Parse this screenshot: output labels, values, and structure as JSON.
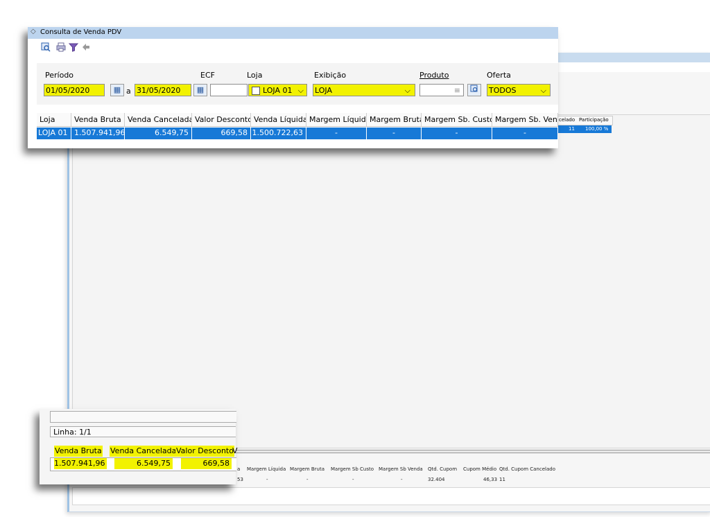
{
  "window": {
    "title": "Consulta de Venda PDV"
  },
  "filters": {
    "periodo_label": "Período",
    "periodo_start": "01/05/2020",
    "periodo_sep": "a",
    "periodo_end": "31/05/2020",
    "ecf_label": "ECF",
    "ecf_value": "",
    "loja_label": "Loja",
    "loja_value": "LOJA 01",
    "exibicao_label": "Exibição",
    "exibicao_value": "LOJA",
    "produto_label": "Produto",
    "produto_value": "",
    "oferta_label": "Oferta",
    "oferta_value": "TODOS"
  },
  "grid": {
    "headers": [
      "Loja",
      "Venda Bruta",
      "Venda Cancelada",
      "Valor Desconto",
      "Venda Líquida",
      "Margem Líquida",
      "Margem Bruta",
      "Margem Sb. Custo",
      "Margem Sb. Venda"
    ],
    "row": [
      "LOJA 01",
      "1.507.941,96",
      "6.549,75",
      "669,58",
      "1.500.722,63",
      "-",
      "-",
      "-",
      "-"
    ]
  },
  "bg_grid_fragment": {
    "headers": [
      "celado",
      "Participação"
    ],
    "row": [
      "11",
      "100,00 %"
    ]
  },
  "bg_footer": {
    "labels": [
      "a",
      "Margem Líquida",
      "Margem Bruta",
      "Margem Sb Custo",
      "Margem Sb Venda",
      "Qtd. Cupom",
      "Cupom Médio",
      "Qtd. Cupom Cancelado"
    ],
    "values": [
      "53",
      "-",
      "-",
      "-",
      "-",
      "32.404",
      "46,33",
      "11"
    ]
  },
  "summary": {
    "linha": "Linha: 1/1",
    "labels": [
      "Venda Bruta",
      "Venda Cancelada",
      "Valor Desconto",
      "V"
    ],
    "values": [
      "1.507.941,96",
      "6.549,75",
      "669,58"
    ]
  },
  "colors": {
    "highlight": "#f2f200",
    "selection": "#1779d7",
    "titlebar": "#bcd4ee"
  },
  "icons": [
    "window-icon",
    "search-icon",
    "print-icon",
    "filter-icon",
    "back-arrow-icon",
    "calendar-icon",
    "chevron-down-icon",
    "lookup-icon"
  ]
}
